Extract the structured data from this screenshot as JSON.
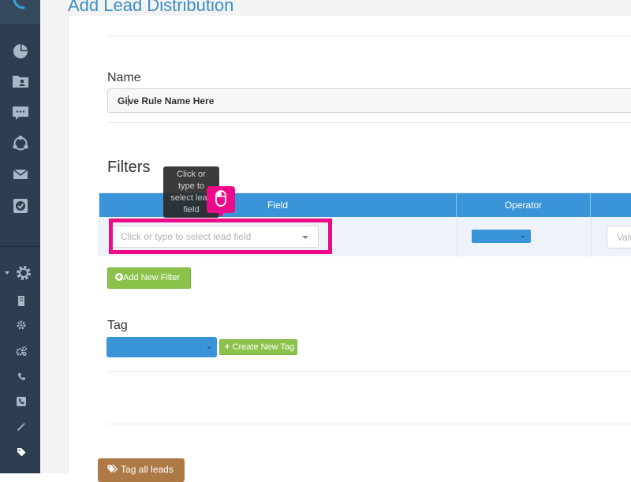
{
  "page": {
    "title": "Add Lead Distribution"
  },
  "sidebar": {
    "icons": [
      "phone-icon",
      "pie-chart-icon",
      "contacts-folder-icon",
      "chat-icon",
      "share-icon",
      "mail-icon",
      "checkbox-icon",
      "settings-gear-icon",
      "building-icon",
      "gear-icon",
      "gears-icon",
      "phone-small-icon",
      "phone-square-icon",
      "magic-wand-icon",
      "tag-icon"
    ]
  },
  "form": {
    "name_label": "Name",
    "name_value_before_caret": "Gi",
    "name_value_after_caret": "ve Rule Name Here",
    "filters_label": "Filters",
    "columns": {
      "field": "Field",
      "operator": "Operator"
    },
    "field_placeholder": "Click or type to select lead field",
    "value_placeholder": "Value",
    "add_filter_label": "Add New Filter",
    "tag_label": "Tag",
    "create_tag_label": "Create New Tag",
    "tag_all_leads_label": "Tag all leads"
  },
  "tooltip": {
    "lines": [
      "Click or",
      "type to",
      "select lead",
      "field"
    ]
  },
  "colors": {
    "sidebar": "#2c3e50",
    "accent_blue": "#3a94d8",
    "highlight": "#ee0b8a",
    "green": "#8bc34a",
    "brown": "#ad7a46"
  }
}
